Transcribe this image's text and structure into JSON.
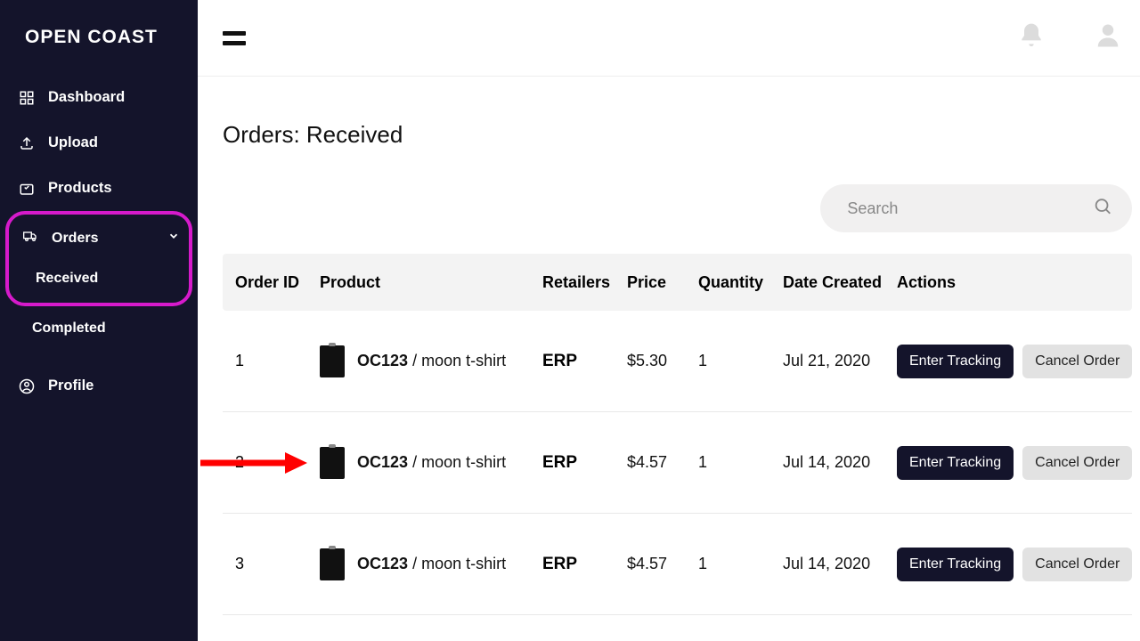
{
  "brand": "OPEN COAST",
  "sidebar": {
    "items": [
      {
        "label": "Dashboard"
      },
      {
        "label": "Upload"
      },
      {
        "label": "Products"
      },
      {
        "label": "Orders"
      },
      {
        "label": "Profile"
      }
    ],
    "orders_sub": [
      {
        "label": "Received"
      },
      {
        "label": "Completed"
      }
    ]
  },
  "page_title": "Orders: Received",
  "search": {
    "placeholder": "Search"
  },
  "table": {
    "headers": {
      "id": "Order ID",
      "product": "Product",
      "retailers": "Retailers",
      "price": "Price",
      "qty": "Quantity",
      "date": "Date Created",
      "actions": "Actions"
    },
    "rows": [
      {
        "id": "1",
        "sku": "OC123",
        "name": "moon t-shirt",
        "retailer": "ERP",
        "price": "$5.30",
        "qty": "1",
        "date": "Jul 21, 2020"
      },
      {
        "id": "2",
        "sku": "OC123",
        "name": "moon t-shirt",
        "retailer": "ERP",
        "price": "$4.57",
        "qty": "1",
        "date": "Jul 14, 2020"
      },
      {
        "id": "3",
        "sku": "OC123",
        "name": "moon t-shirt",
        "retailer": "ERP",
        "price": "$4.57",
        "qty": "1",
        "date": "Jul 14, 2020"
      }
    ]
  },
  "buttons": {
    "enter_tracking": "Enter Tracking",
    "cancel_order": "Cancel Order"
  }
}
